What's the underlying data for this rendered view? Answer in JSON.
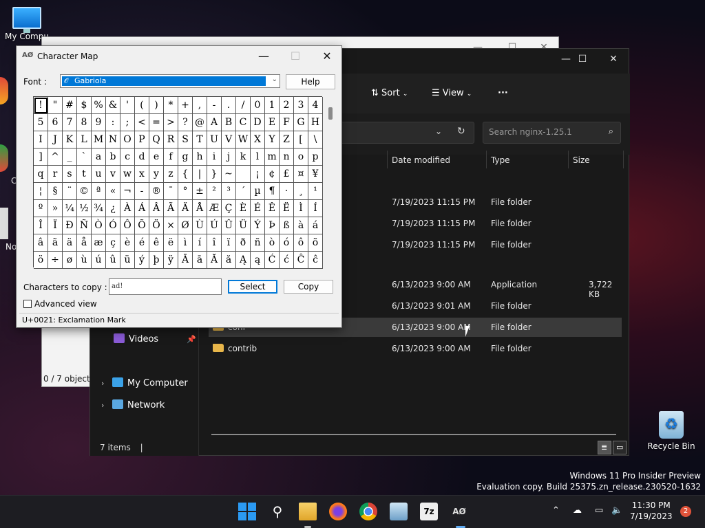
{
  "desktop": {
    "icons": {
      "my_computer": "My Compu",
      "recycle_bin": "Recycle Bin",
      "partial_no": "No",
      "partial_c": "C"
    },
    "watermark": {
      "line1": "Windows 11 Pro Insider Preview",
      "line2": "Evaluation copy. Build 25375.zn_release.230520-1632"
    }
  },
  "background_window": {
    "status": "0 / 7 object(s"
  },
  "explorer": {
    "toolbar": {
      "sort": "Sort",
      "view": "View",
      "more": "···"
    },
    "search_placeholder": "Search nginx-1.25.1",
    "columns": {
      "date": "Date modified",
      "type": "Type",
      "size": "Size"
    },
    "rows": [
      {
        "name": "",
        "date": "7/19/2023 11:15 PM",
        "type": "File folder",
        "size": ""
      },
      {
        "name": "",
        "date": "7/19/2023 11:15 PM",
        "type": "File folder",
        "size": ""
      },
      {
        "name": "",
        "date": "7/19/2023 11:15 PM",
        "type": "File folder",
        "size": ""
      },
      {
        "name": "",
        "date": "6/13/2023 9:00 AM",
        "type": "Application",
        "size": "3,722 KB"
      },
      {
        "name": "",
        "date": "6/13/2023 9:01 AM",
        "type": "File folder",
        "size": ""
      },
      {
        "name": "conf",
        "date": "6/13/2023 9:00 AM",
        "type": "File folder",
        "size": ""
      },
      {
        "name": "contrib",
        "date": "6/13/2023 9:00 AM",
        "type": "File folder",
        "size": ""
      }
    ],
    "nav": {
      "videos": "Videos",
      "my_computer": "My Computer",
      "network": "Network"
    },
    "status": "7 items"
  },
  "charmap": {
    "title": "Character Map",
    "font_label": "Font :",
    "font_value": "Gabriola",
    "help": "Help",
    "copy_label": "Characters to copy :",
    "copy_value": "ad!",
    "select": "Select",
    "copy": "Copy",
    "advanced": "Advanced view",
    "status": "U+0021: Exclamation Mark",
    "grid": [
      [
        "!",
        "\"",
        "#",
        "$",
        "%",
        "&",
        "'",
        "(",
        ")",
        "*",
        "+",
        ",",
        "-",
        ".",
        "/",
        "0",
        "1",
        "2",
        "3",
        "4"
      ],
      [
        "5",
        "6",
        "7",
        "8",
        "9",
        ":",
        ";",
        "<",
        "=",
        ">",
        "?",
        "@",
        "A",
        "B",
        "C",
        "D",
        "E",
        "F",
        "G",
        "H"
      ],
      [
        "I",
        "J",
        "K",
        "L",
        "M",
        "N",
        "O",
        "P",
        "Q",
        "R",
        "S",
        "T",
        "U",
        "V",
        "W",
        "X",
        "Y",
        "Z",
        "[",
        "\\"
      ],
      [
        "]",
        "^",
        "_",
        "`",
        "a",
        "b",
        "c",
        "d",
        "e",
        "f",
        "g",
        "h",
        "i",
        "j",
        "k",
        "l",
        "m",
        "n",
        "o",
        "p"
      ],
      [
        "q",
        "r",
        "s",
        "t",
        "u",
        "v",
        "w",
        "x",
        "y",
        "z",
        "{",
        "|",
        "}",
        "~",
        " ",
        "¡",
        "¢",
        "£",
        "¤",
        "¥"
      ],
      [
        "¦",
        "§",
        "¨",
        "©",
        "ª",
        "«",
        "¬",
        "-",
        "®",
        "¯",
        "°",
        "±",
        "²",
        "³",
        "´",
        "µ",
        "¶",
        "·",
        "¸",
        "¹"
      ],
      [
        "º",
        "»",
        "¼",
        "½",
        "¾",
        "¿",
        "À",
        "Á",
        "Â",
        "Ã",
        "Ä",
        "Å",
        "Æ",
        "Ç",
        "È",
        "É",
        "Ê",
        "Ë",
        "Ì",
        "Í"
      ],
      [
        "Î",
        "Ï",
        "Ð",
        "Ñ",
        "Ò",
        "Ó",
        "Ô",
        "Õ",
        "Ö",
        "×",
        "Ø",
        "Ù",
        "Ú",
        "Û",
        "Ü",
        "Ý",
        "Þ",
        "ß",
        "à",
        "á"
      ],
      [
        "â",
        "ã",
        "ä",
        "å",
        "æ",
        "ç",
        "è",
        "é",
        "ê",
        "ë",
        "ì",
        "í",
        "î",
        "ï",
        "ð",
        "ñ",
        "ò",
        "ó",
        "ô",
        "õ"
      ],
      [
        "ö",
        "÷",
        "ø",
        "ù",
        "ú",
        "û",
        "ü",
        "ý",
        "þ",
        "ÿ",
        "Ā",
        "ā",
        "Ă",
        "ă",
        "Ą",
        "ą",
        "Ć",
        "ć",
        "Ĉ",
        "ĉ"
      ]
    ]
  },
  "taskbar": {
    "time": "11:30 PM",
    "date": "7/19/2023",
    "notifications": "2",
    "seven_zip": "7z"
  },
  "colors": {
    "accent": "#0078d7",
    "folder": "#e8b64a"
  }
}
